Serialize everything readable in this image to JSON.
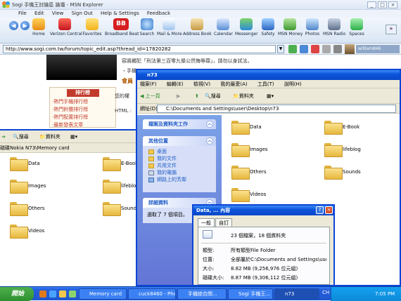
{
  "msn": {
    "title": "Sogi 手機王討論區 論壇 - MSN Explorer",
    "menu": [
      "File",
      "Edit",
      "View",
      "Sign Out",
      "Help & Settings",
      "Feedback"
    ],
    "toolbar": [
      "Home",
      "Verizon Central",
      "Favorites",
      "Broadband Beat",
      "Search",
      "Mail & More",
      "Address Book",
      "Calendar",
      "Messenger",
      "Safety",
      "MSN Money",
      "Photos",
      "MSN Radio",
      "Spaces"
    ],
    "address": "http://www.sogi.com.tw/forum/topic_edit.asp?thread_id=17820282",
    "user": "william846"
  },
  "web": {
    "notice": "容將觸犯「刑法第三百零九條公然侮辱罪」，請勿以身試法。",
    "notice2": "・手機",
    "member": "會員",
    "ranking_title": "排行榜",
    "ranking_items": [
      "‧熱門手機排行榜",
      "‧熱門鈴聲排行榜",
      "‧熱門配置排行榜",
      "‧最新發表文章"
    ],
    "your_perm": "您的權",
    "html_label": "HTML :"
  },
  "explorer_back": {
    "search": "搜尋",
    "folders": "資料夾",
    "path": "磁碟Nokia N73\\Memory card",
    "items": [
      "Data",
      "E-Book",
      "Images",
      "lifeblog",
      "Others",
      "Sounds",
      "Videos"
    ]
  },
  "explorer_front": {
    "title": "n73",
    "menu": [
      "檔案(F)",
      "編輯(E)",
      "檢視(V)",
      "我的最愛(A)",
      "工具(T)",
      "說明(H)"
    ],
    "back": "上一頁",
    "search": "搜尋",
    "folders": "資料夾",
    "address_label": "網址(D)",
    "path": "C:\\Documents and Settings\\user\\Desktop\\n73",
    "items": [
      "Data",
      "E-Book",
      "Images",
      "lifeblog",
      "Others",
      "Sounds",
      "Videos"
    ],
    "pane1": "檔案及資料夾工作",
    "pane2": "其他位置",
    "places": [
      "桌面",
      "我的文件",
      "共用文件",
      "我的電腦",
      "網路上的芳鄰"
    ],
    "pane3": "詳細資料",
    "details": "選取了 7 個項目。"
  },
  "props": {
    "title": "Data, ... 內容",
    "tabs": [
      "一般",
      "自訂"
    ],
    "summary": "23 個檔案，18 個資料夾",
    "type_label": "類型:",
    "type_value": "所有類型File Folder",
    "loc_label": "位置:",
    "loc_value": "全部屬於C:\\Documents and Settings\\user\\Desktop\\n",
    "size_label": "大小:",
    "size_value": "8.82 MB (9,256,976 位元組)",
    "disk_label": "磁碟大小:",
    "disk_value": "8.87 MB (9,306,112 位元組)"
  },
  "taskbar": {
    "start": "開始",
    "items": [
      "Memory card",
      "cuck8460 - Pho...",
      "手機綜合問...",
      "Sogi 手機王...",
      "n73"
    ],
    "lang": "CH",
    "time": "7:05 PM"
  }
}
